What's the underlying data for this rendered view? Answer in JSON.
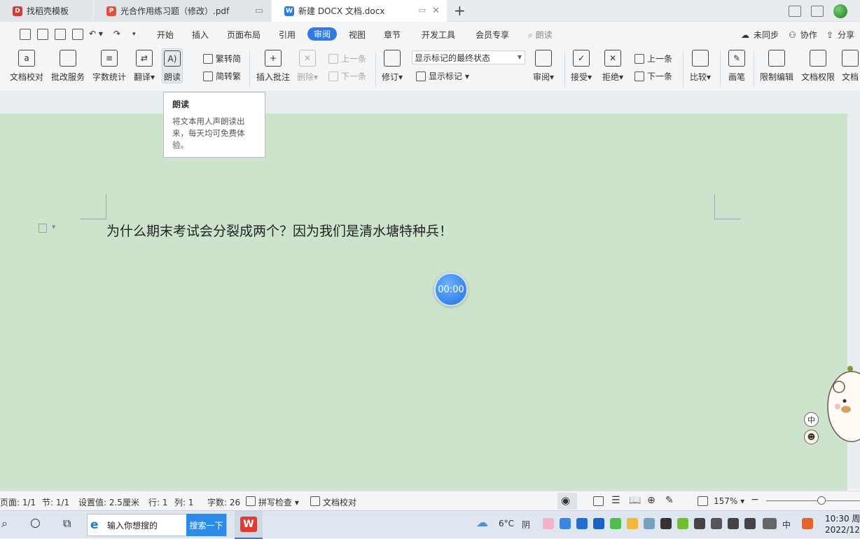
{
  "tabs": [
    {
      "label": "找稻壳模板",
      "color": "#d23b32"
    },
    {
      "label": "光合作用练习题（修改）.pdf",
      "color": "#e0523d"
    },
    {
      "label": "新建 DOCX 文档.docx",
      "color": "#2e7ae6"
    }
  ],
  "tab_icon_letters": {
    "doc": "W",
    "pdf": "P",
    "daoke": "D"
  },
  "menu": {
    "items": [
      "开始",
      "插入",
      "页面布局",
      "引用",
      "审阅",
      "视图",
      "章节",
      "开发工具",
      "会员专享"
    ],
    "active": "审阅",
    "search_hint": "朗读",
    "sync": "未同步",
    "collab": "协作",
    "share": "分享"
  },
  "ribbon": {
    "proofread": "文档校对",
    "correction": "批改服务",
    "wordcount": "字数统计",
    "translate": "翻译",
    "read_aloud": "朗读",
    "trad": "繁转简",
    "simp": "简转繁",
    "insert_comment": "插入批注",
    "delete": "删除",
    "prev_comment": "上一条",
    "next_comment": "下一条",
    "revise": "修订",
    "markup_state": "显示标记的最终状态",
    "show_markup": "显示标记",
    "review": "审阅",
    "accept": "接受",
    "reject": "拒绝",
    "prev_change": "上一条",
    "next_change": "下一条",
    "compare": "比较",
    "ink": "画笔",
    "restrict": "限制编辑",
    "permission": "文档权限",
    "more": "文档"
  },
  "tooltip": {
    "title": "朗读",
    "desc": "将文本用人声朗读出来，每天均可免费体验。"
  },
  "document": {
    "text": "为什么期末考试会分裂成两个？因为我们是清水塘特种兵！",
    "timer": "00:00"
  },
  "ime": {
    "lang": "中"
  },
  "status": {
    "page": "页面: 1/1",
    "section": "节: 1/1",
    "setting": "设置值: 2.5厘米",
    "row": "行: 1",
    "col": "列: 1",
    "chars": "字数: 26",
    "spell": "拼写检查",
    "proof": "文档校对",
    "zoom": "157%"
  },
  "taskbar": {
    "search_placeholder": "输入你想搜的",
    "search_button": "搜索一下",
    "weather_temp": "6°C",
    "weather_desc": "阴",
    "ime": "中",
    "time": "10:30 周",
    "date": "2022/12/"
  }
}
